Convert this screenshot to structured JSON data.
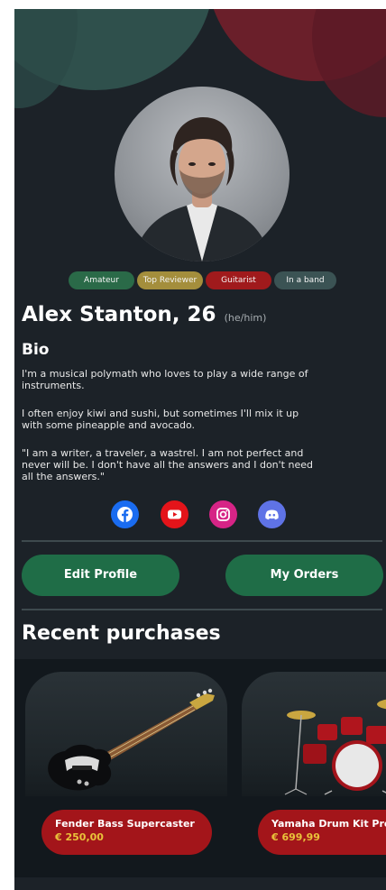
{
  "profile": {
    "name": "Alex Stanton, 26",
    "pronouns": "(he/him)"
  },
  "tags": [
    {
      "label": "Amateur",
      "color": "#2a6a48"
    },
    {
      "label": "Top Reviewer",
      "color": "#a48e3c"
    },
    {
      "label": "Guitarist",
      "color": "#a01a1c"
    },
    {
      "label": "In a band",
      "color": "#3b5354"
    }
  ],
  "bio": {
    "title": "Bio",
    "paragraphs": [
      "I'm a musical polymath who loves to play a wide range of instruments.",
      "I often enjoy kiwi and sushi, but sometimes I'll mix it up with some pineapple and avocado.",
      "\"I am a writer, a traveler, a wastrel. I am not perfect and never will be. I don't have all the answers and I don't need all the answers.\""
    ]
  },
  "social": [
    {
      "icon": "facebook-icon",
      "color": "#1a6cf0"
    },
    {
      "icon": "youtube-icon",
      "color": "#e4141a"
    },
    {
      "icon": "instagram-icon",
      "color": "#d62486"
    },
    {
      "icon": "discord-icon",
      "color": "#5f73e6"
    }
  ],
  "actions": {
    "edit_profile": "Edit Profile",
    "my_orders": "My Orders"
  },
  "recent": {
    "title": "Recent purchases",
    "items": [
      {
        "name": "Fender Bass Supercaster",
        "price": "€ 250,00",
        "image": "bass-guitar-image"
      },
      {
        "name": "Yamaha Drum Kit Pro",
        "price": "€ 699,99",
        "image": "drum-kit-image"
      }
    ]
  },
  "colors": {
    "background": "#1c2228",
    "accent_green": "#1f6d47",
    "accent_red": "#a3151a",
    "price_gold": "#e9c23a"
  }
}
